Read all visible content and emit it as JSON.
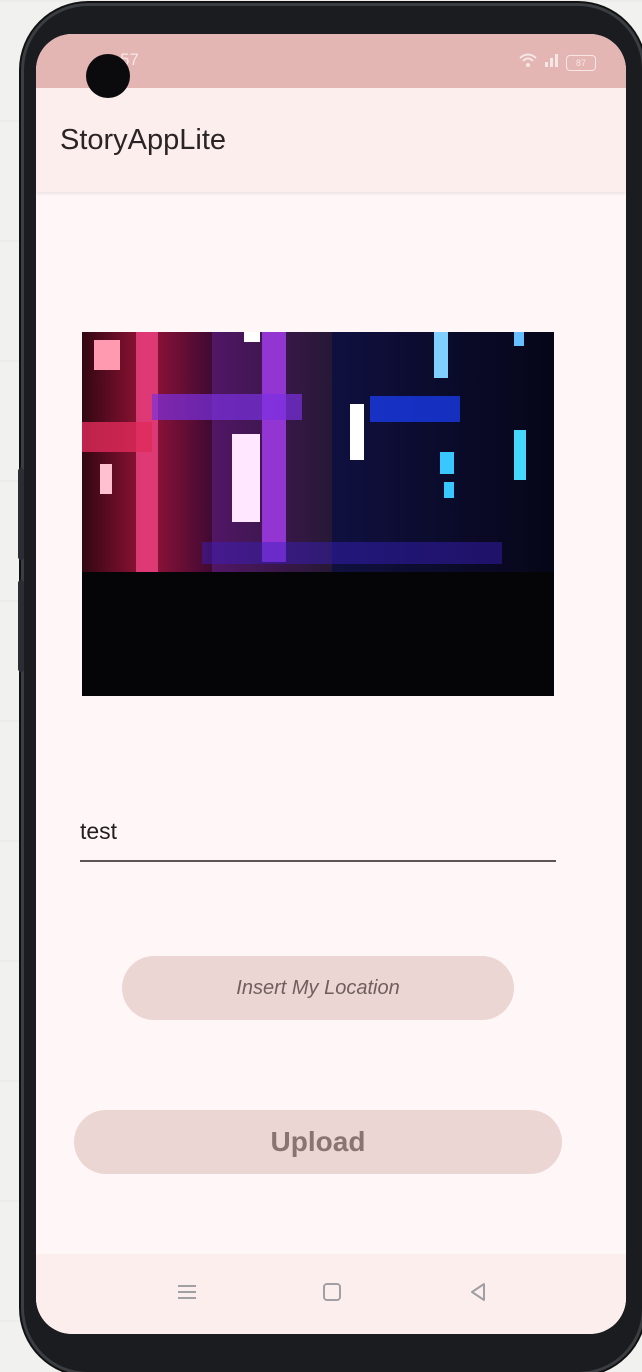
{
  "status_bar": {
    "time": "57",
    "battery": "87"
  },
  "app_bar": {
    "title": "StoryAppLite"
  },
  "story_form": {
    "description_value": "test",
    "insert_location_label": "Insert My Location",
    "upload_label": "Upload"
  },
  "icons": {
    "wifi": "wifi-icon",
    "signal": "signal-icon",
    "battery": "battery-icon",
    "menu": "menu-icon",
    "home": "home-icon",
    "back": "back-icon"
  },
  "colors": {
    "status_bar": "#e3b5b3",
    "app_bar": "#fdeeee",
    "background": "#fff7f7",
    "button_fill": "#ecd6d3",
    "upload_text": "#8a7370"
  }
}
